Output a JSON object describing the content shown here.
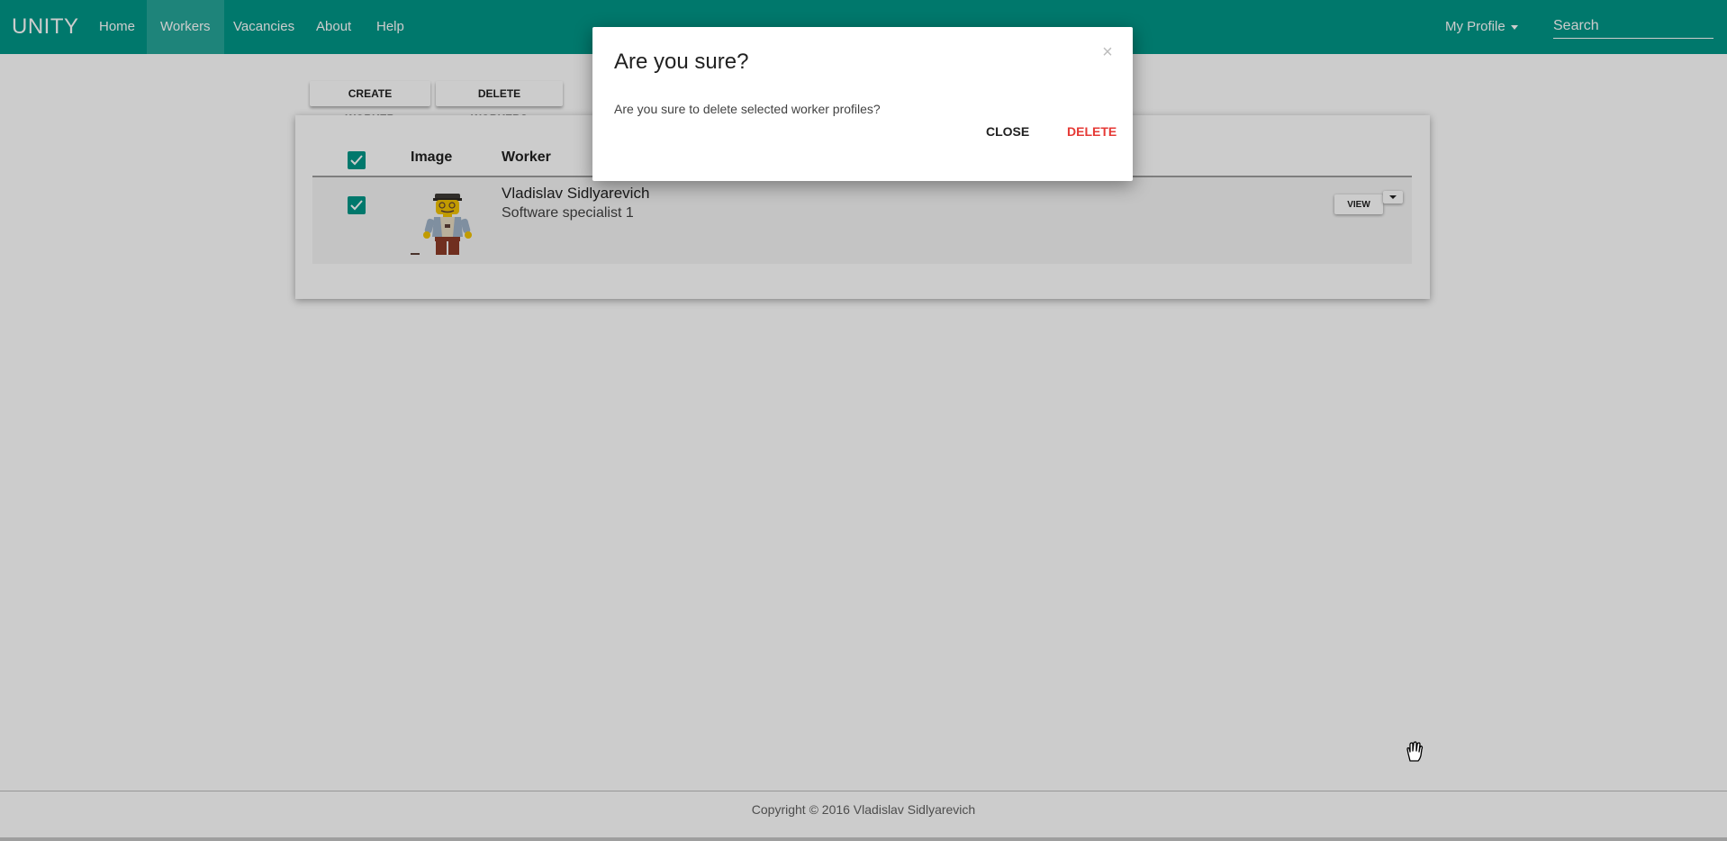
{
  "navbar": {
    "brand": "UNITY",
    "items": [
      {
        "label": "Home"
      },
      {
        "label": "Workers",
        "active": true
      },
      {
        "label": "Vacancies"
      },
      {
        "label": "About"
      },
      {
        "label": "Help"
      }
    ],
    "profile_label": "My Profile",
    "search_placeholder": "Search"
  },
  "toolbar": {
    "create_label": "CREATE WORKER",
    "delete_label": "DELETE WORKERS"
  },
  "table": {
    "columns": [
      "Image",
      "Worker"
    ],
    "header_checked": true,
    "rows": [
      {
        "checked": true,
        "name": "Vladislav Sidlyarevich",
        "role": "Software specialist 1",
        "view_label": "VIEW"
      }
    ]
  },
  "footer": {
    "copyright": "Copyright © 2016 Vladislav Sidlyarevich"
  },
  "modal": {
    "title": "Are you sure?",
    "close_x": "×",
    "body": "Are you sure to delete selected worker profiles?",
    "close_label": "CLOSE",
    "delete_label": "DELETE"
  },
  "colors": {
    "primary": "#009688",
    "danger": "#e53935"
  }
}
